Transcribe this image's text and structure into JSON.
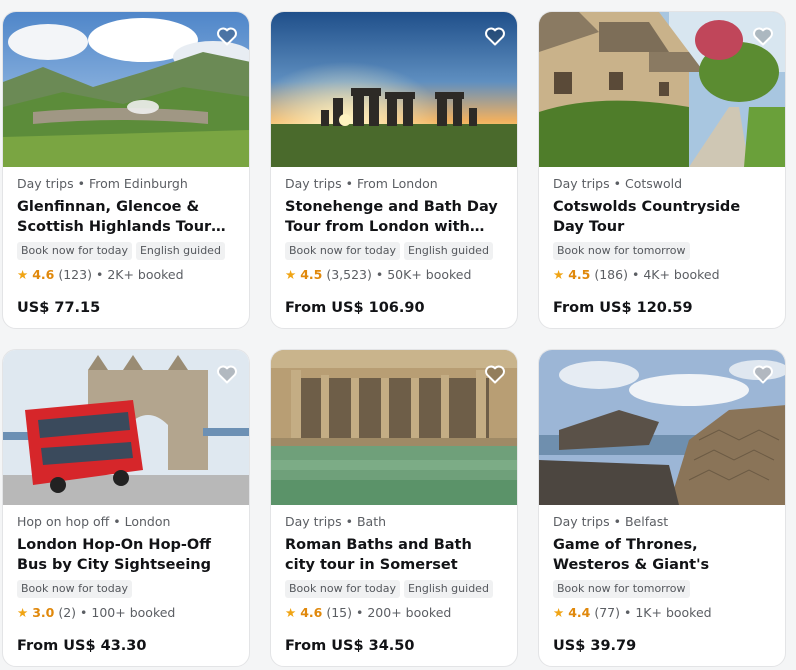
{
  "cards": [
    {
      "category": "Day trips",
      "location": "From Edinburgh",
      "title": "Glenfinnan, Glencoe & Scottish Highlands Tour…",
      "badges": [
        "Book now for today",
        "English guided"
      ],
      "rating": "4.6",
      "reviews": "(123)",
      "booked": "2K+ booked",
      "price": "US$ 77.15",
      "favorite_icon": "heart-outline-icon"
    },
    {
      "category": "Day trips",
      "location": "From London",
      "title": "Stonehenge and Bath Day Tour from London with…",
      "badges": [
        "Book now for today",
        "English guided"
      ],
      "rating": "4.5",
      "reviews": "(3,523)",
      "booked": "50K+ booked",
      "price": "From US$ 106.90",
      "favorite_icon": "heart-outline-icon"
    },
    {
      "category": "Day trips",
      "location": "Cotswold",
      "title": "Cotswolds Countryside Day Tour",
      "badges": [
        "Book now for tomorrow"
      ],
      "rating": "4.5",
      "reviews": "(186)",
      "booked": "4K+ booked",
      "price": "From US$ 120.59",
      "favorite_icon": "heart-outline-icon"
    },
    {
      "category": "Hop on hop off",
      "location": "London",
      "title": "London Hop-On Hop-Off Bus by City Sightseeing",
      "badges": [
        "Book now for today"
      ],
      "rating": "3.0",
      "reviews": "(2)",
      "booked": "100+ booked",
      "price": "From US$ 43.30",
      "favorite_icon": "heart-outline-icon"
    },
    {
      "category": "Day trips",
      "location": "Bath",
      "title": "Roman Baths and Bath city tour in Somerset",
      "badges": [
        "Book now for today",
        "English guided"
      ],
      "rating": "4.6",
      "reviews": "(15)",
      "booked": "200+ booked",
      "price": "From US$ 34.50",
      "favorite_icon": "heart-outline-icon"
    },
    {
      "category": "Day trips",
      "location": "Belfast",
      "title": "Game of Thrones, Westeros & Giant's Causeway Day…",
      "badges": [
        "Book now for tomorrow"
      ],
      "rating": "4.4",
      "reviews": "(77)",
      "booked": "1K+ booked",
      "price": "US$ 39.79",
      "favorite_icon": "heart-outline-icon"
    }
  ],
  "separator": "•",
  "colors": {
    "star": "#f0a414",
    "rating_text": "#e0880b",
    "badge_bg": "#f0f1f2"
  }
}
